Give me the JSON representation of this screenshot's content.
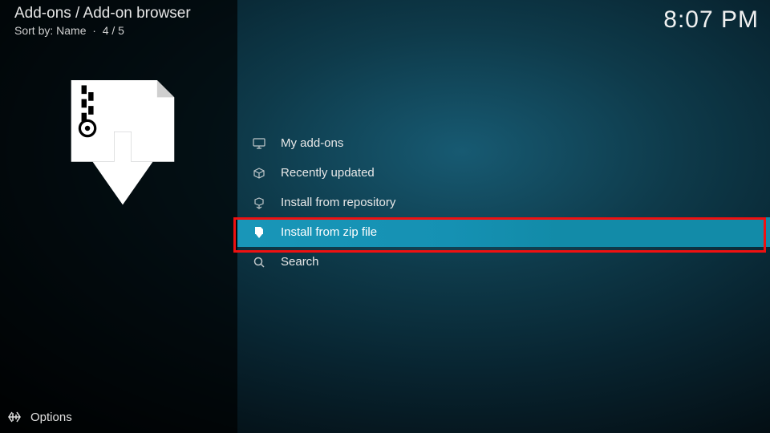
{
  "header": {
    "breadcrumb": "Add-ons / Add-on browser",
    "sort_label": "Sort by: Name",
    "counter": "4 / 5",
    "time": "8:07 PM"
  },
  "menu": {
    "items": [
      {
        "label": "My add-ons",
        "selected": false,
        "icon": "monitor"
      },
      {
        "label": "Recently updated",
        "selected": false,
        "icon": "box"
      },
      {
        "label": "Install from repository",
        "selected": false,
        "icon": "repo"
      },
      {
        "label": "Install from zip file",
        "selected": true,
        "icon": "zip-down"
      },
      {
        "label": "Search",
        "selected": false,
        "icon": "search"
      }
    ]
  },
  "footer": {
    "options_label": "Options"
  },
  "highlight_index": 3
}
